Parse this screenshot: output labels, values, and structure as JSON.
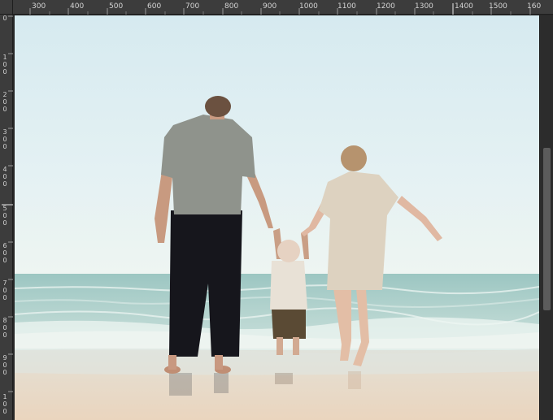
{
  "rulers": {
    "top_labels": [
      "300",
      "400",
      "500",
      "600",
      "700",
      "800",
      "900",
      "1000",
      "1100",
      "1200",
      "1300",
      "1400",
      "1500",
      "160"
    ],
    "left_labels": [
      "0",
      "100",
      "200",
      "300",
      "400",
      "500",
      "600",
      "700",
      "800",
      "900",
      "100"
    ]
  },
  "canvas": {
    "image_name": "beach-family-photo",
    "colors": {
      "sky_top": "#d9ecf0",
      "sky_bottom": "#eaf4f3",
      "sea": "#a8ccc7",
      "sand": "#e9d8c4"
    }
  },
  "icons": {
    "scrollbar": "vertical-scrollbar"
  }
}
